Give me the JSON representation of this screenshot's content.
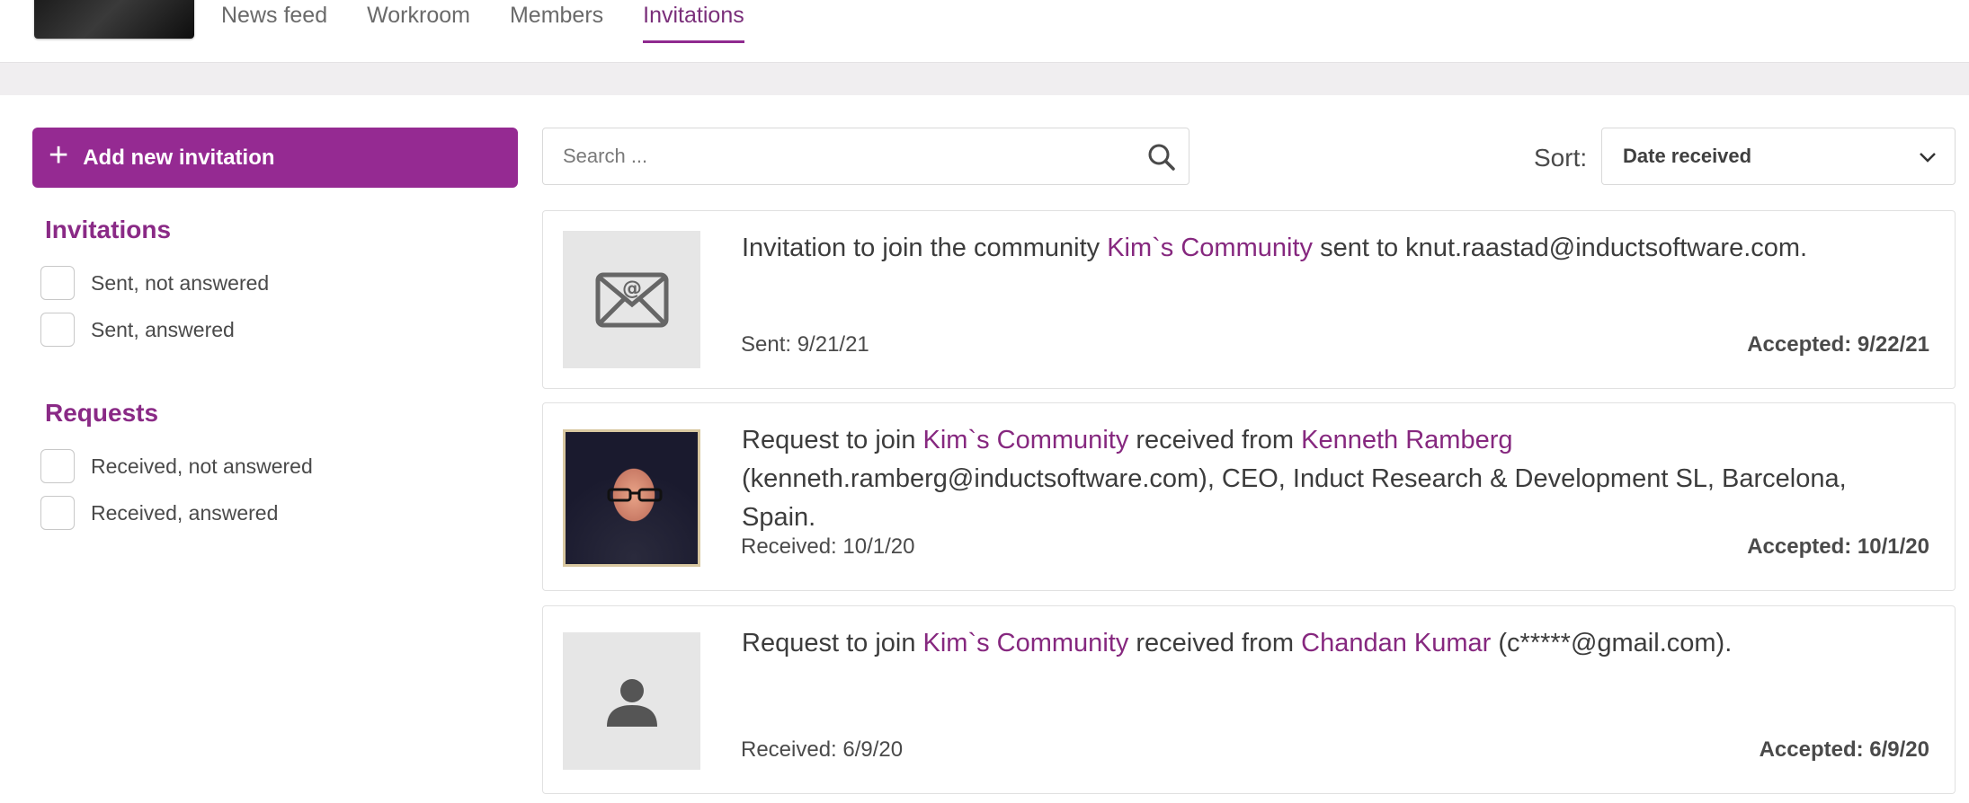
{
  "nav": {
    "tabs": [
      "News feed",
      "Workroom",
      "Members",
      "Invitations"
    ],
    "active": "Invitations"
  },
  "sidebar": {
    "add_button": "Add new invitation",
    "invitations_heading": "Invitations",
    "invitations_filters": [
      "Sent, not answered",
      "Sent, answered"
    ],
    "requests_heading": "Requests",
    "requests_filters": [
      "Received, not answered",
      "Received, answered"
    ]
  },
  "search": {
    "placeholder": "Search ..."
  },
  "sort": {
    "label": "Sort:",
    "value": "Date received"
  },
  "cards": [
    {
      "type": "invitation",
      "text_a": "Invitation to join the community ",
      "community": "Kim`s Community",
      "text_b": " sent to knut.raastad@inductsoftware.com.",
      "date": "Sent: 9/21/21",
      "accepted": "Accepted: 9/22/21",
      "icon": "envelope-at-icon"
    },
    {
      "type": "request",
      "text_a": "Request to join ",
      "community": "Kim`s Community",
      "text_b": " received from ",
      "person": "Kenneth Ramberg",
      "text_c": " (kenneth.ramberg@inductsoftware.com), CEO, Induct Research & Development SL, Barcelona, Spain.",
      "date": "Received: 10/1/20",
      "accepted": "Accepted: 10/1/20",
      "icon": "profile-photo"
    },
    {
      "type": "request",
      "text_a": "Request to join ",
      "community": "Kim`s Community",
      "text_b": " received from ",
      "person": "Chandan Kumar",
      "text_c": " (c*****@gmail.com).",
      "date": "Received: 6/9/20",
      "accepted": "Accepted: 6/9/20",
      "icon": "person-placeholder-icon"
    }
  ],
  "colors": {
    "accent": "#952a92",
    "link": "#86287f",
    "band": "#f0eef0"
  }
}
